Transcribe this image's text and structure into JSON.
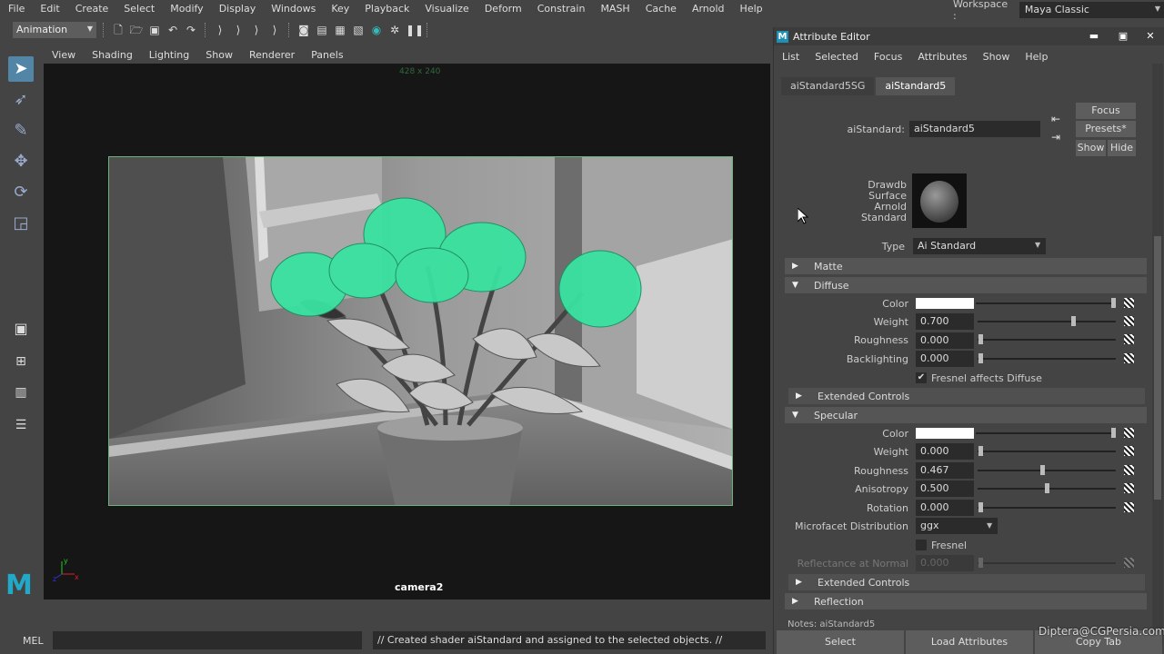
{
  "menubar": {
    "items": [
      "File",
      "Edit",
      "Create",
      "Select",
      "Modify",
      "Display",
      "Windows",
      "Key",
      "Playback",
      "Visualize",
      "Deform",
      "Constrain",
      "MASH",
      "Cache",
      "Arnold",
      "Help"
    ]
  },
  "workspace": {
    "label": "Workspace :",
    "value": "Maya Classic"
  },
  "toolbar": {
    "mode": "Animation"
  },
  "viewport": {
    "menu": [
      "View",
      "Shading",
      "Lighting",
      "Show",
      "Renderer",
      "Panels"
    ],
    "resolution_gate": "428 x 240",
    "camera_label": "camera2",
    "axis_x": "x",
    "axis_y": "y",
    "axis_z": "z",
    "logo": "M"
  },
  "cmdline": {
    "lang": "MEL",
    "result": "// Created shader aiStandard and assigned to the selected objects. //"
  },
  "ae": {
    "title": "Attribute Editor",
    "logo": "M",
    "win_min": "▬",
    "win_max": "▣",
    "win_close": "✕",
    "menu": [
      "List",
      "Selected",
      "Focus",
      "Attributes",
      "Show",
      "Help"
    ],
    "tabs": [
      "aiStandard5SG",
      "aiStandard5"
    ],
    "node_label": "aiStandard:",
    "node_value": "aiStandard5",
    "focus": "Focus",
    "presets": "Presets*",
    "show": "Show",
    "hide": "Hide",
    "swatch_caption": [
      "Drawdb",
      "Surface",
      "Arnold",
      "Standard"
    ],
    "type_label": "Type",
    "type_value": "Ai Standard",
    "sections": {
      "matte": "Matte",
      "diffuse": "Diffuse",
      "ext1": "Extended Controls",
      "specular": "Specular",
      "ext2": "Extended Controls",
      "reflection": "Reflection"
    },
    "diffuse": {
      "color_label": "Color",
      "weight_label": "Weight",
      "weight": "0.700",
      "roughness_label": "Roughness",
      "roughness": "0.000",
      "backlighting_label": "Backlighting",
      "backlighting": "0.000",
      "fresnel_label": "Fresnel affects Diffuse"
    },
    "specular": {
      "color_label": "Color",
      "weight_label": "Weight",
      "weight": "0.000",
      "roughness_label": "Roughness",
      "roughness": "0.467",
      "anisotropy_label": "Anisotropy",
      "anisotropy": "0.500",
      "rotation_label": "Rotation",
      "rotation": "0.000",
      "microfacet_label": "Microfacet Distribution",
      "microfacet": "ggx",
      "fresnel_label": "Fresnel",
      "reflectance_label": "Reflectance at Normal",
      "reflectance": "0.000"
    },
    "sliders": {
      "d_weight": 0.7,
      "d_rough": 0.0,
      "d_back": 0.0,
      "s_weight": 0.0,
      "s_rough": 0.467,
      "s_aniso": 0.5,
      "s_rot": 0.0
    },
    "notes": "Notes: aiStandard5",
    "bottom": [
      "Select",
      "Load Attributes",
      "Copy Tab"
    ]
  },
  "watermark": "Diptera@CGPersia.com"
}
